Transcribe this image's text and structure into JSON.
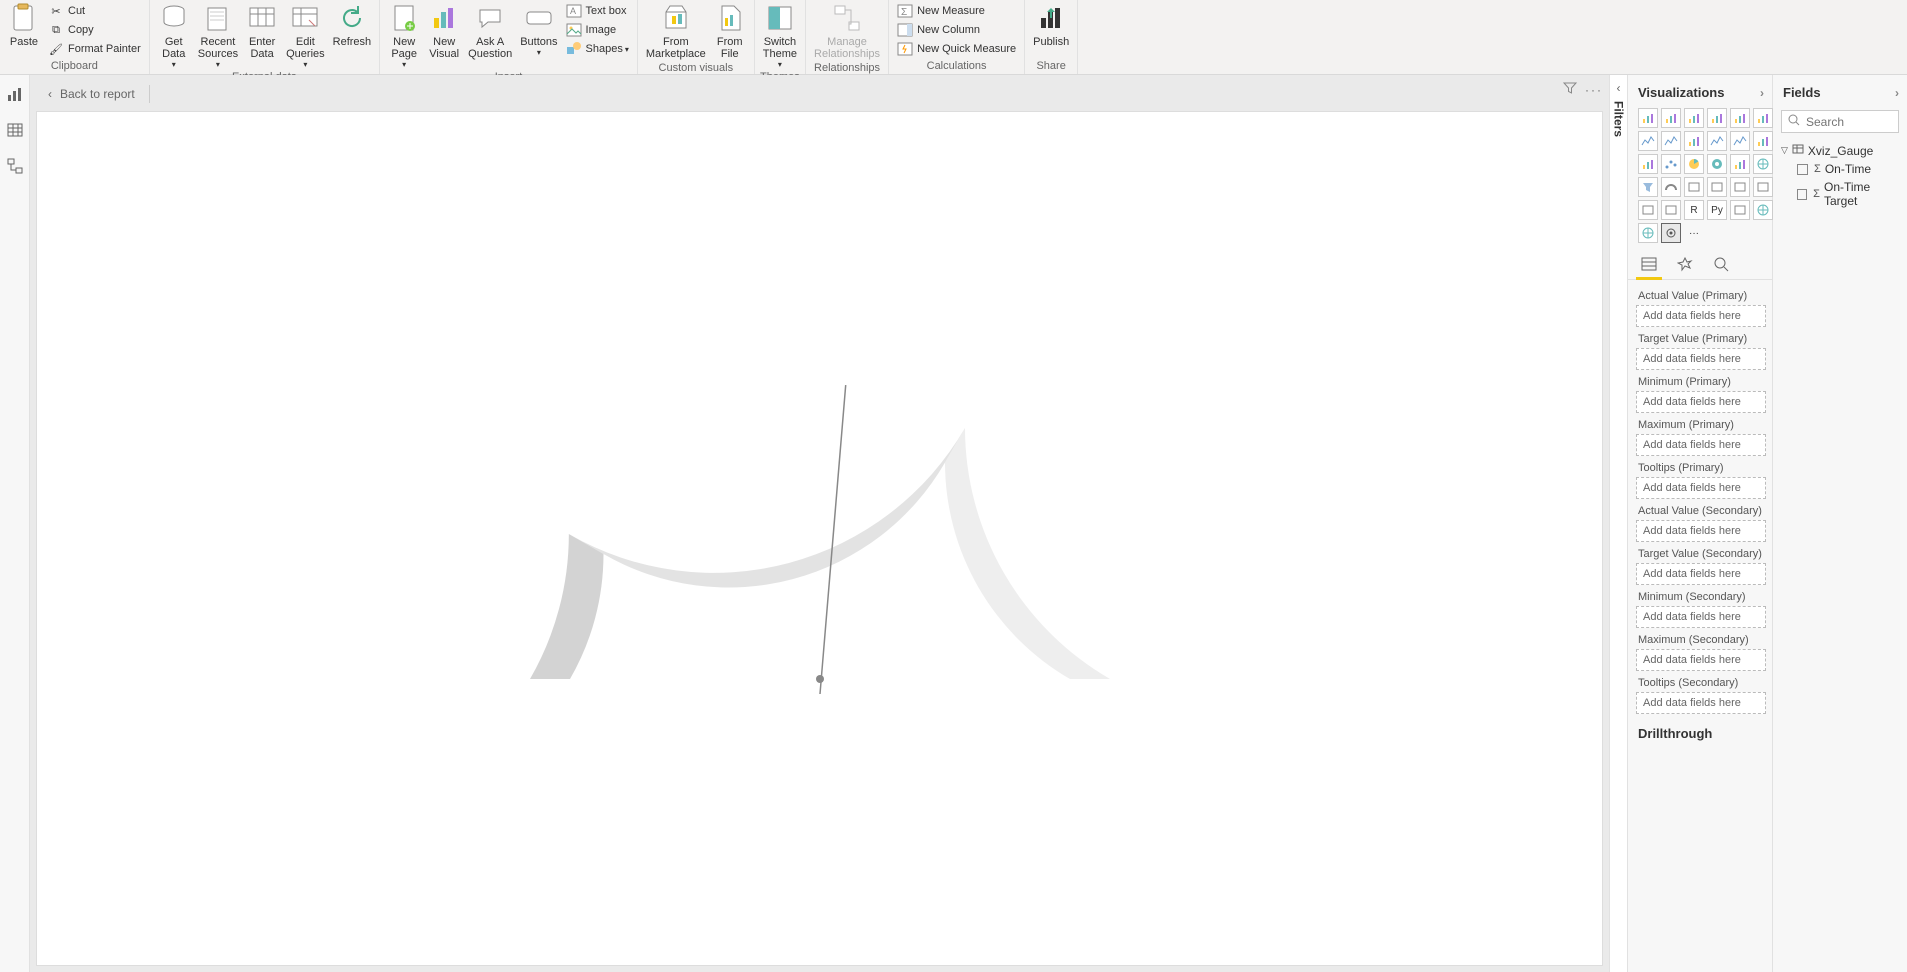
{
  "ribbon": {
    "clipboard": {
      "label": "Clipboard",
      "paste": "Paste",
      "cut": "Cut",
      "copy": "Copy",
      "format_painter": "Format Painter"
    },
    "external_data": {
      "label": "External data",
      "get_data": "Get\nData",
      "recent_sources": "Recent\nSources",
      "enter_data": "Enter\nData",
      "edit_queries": "Edit\nQueries",
      "refresh": "Refresh"
    },
    "insert": {
      "label": "Insert",
      "new_page": "New\nPage",
      "new_visual": "New\nVisual",
      "ask": "Ask A\nQuestion",
      "buttons": "Buttons",
      "text_box": "Text box",
      "image": "Image",
      "shapes": "Shapes"
    },
    "custom_visuals": {
      "label": "Custom visuals",
      "from_marketplace": "From\nMarketplace",
      "from_file": "From\nFile"
    },
    "themes": {
      "label": "Themes",
      "switch_theme": "Switch\nTheme"
    },
    "relationships": {
      "label": "Relationships",
      "manage": "Manage\nRelationships"
    },
    "calculations": {
      "label": "Calculations",
      "new_measure": "New Measure",
      "new_column": "New Column",
      "new_quick_measure": "New Quick Measure"
    },
    "share": {
      "label": "Share",
      "publish": "Publish"
    }
  },
  "canvas": {
    "back": "Back to report"
  },
  "filters": {
    "label": "Filters"
  },
  "viz": {
    "title": "Visualizations",
    "wells": [
      "Actual Value (Primary)",
      "Target Value (Primary)",
      "Minimum (Primary)",
      "Maximum (Primary)",
      "Tooltips (Primary)",
      "Actual Value (Secondary)",
      "Target Value (Secondary)",
      "Minimum (Secondary)",
      "Maximum (Secondary)",
      "Tooltips (Secondary)"
    ],
    "drop_placeholder": "Add data fields here",
    "drill": "Drillthrough"
  },
  "fields": {
    "title": "Fields",
    "search_placeholder": "Search",
    "table": "Xviz_Gauge",
    "cols": [
      "On-Time",
      "On-Time Target"
    ]
  },
  "chart_data": {
    "type": "gauge",
    "segments": [
      {
        "start_deg": 180,
        "end_deg": 120,
        "color": "#eeeeee"
      },
      {
        "start_deg": 120,
        "end_deg": 30,
        "color": "#e3e3e3"
      },
      {
        "start_deg": 30,
        "end_deg": 0,
        "color": "#d3d3d3"
      }
    ],
    "needle_deg": 95,
    "value": null,
    "min": null,
    "max": null
  }
}
